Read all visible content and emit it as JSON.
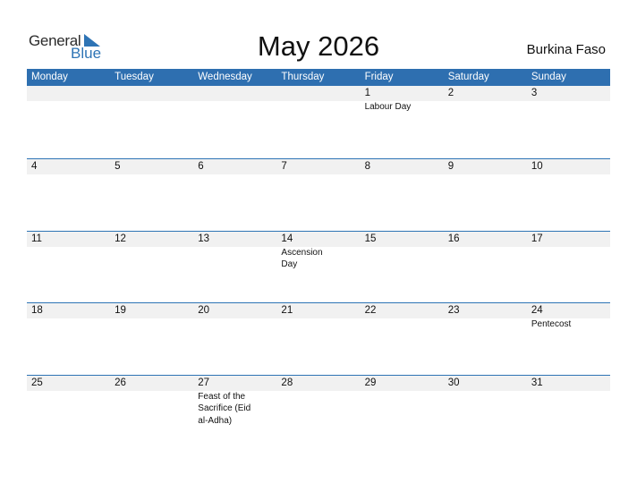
{
  "logo": {
    "general": "General",
    "blue": "Blue"
  },
  "title": "May 2026",
  "country": "Burkina Faso",
  "colors": {
    "accent": "#2e74b5",
    "header_bg": "#2e6fb0",
    "date_strip": "#f1f1f1"
  },
  "weekdays": [
    "Monday",
    "Tuesday",
    "Wednesday",
    "Thursday",
    "Friday",
    "Saturday",
    "Sunday"
  ],
  "weeks": [
    {
      "days": [
        "",
        "",
        "",
        "",
        "1",
        "2",
        "3"
      ],
      "events": [
        "",
        "",
        "",
        "",
        "Labour Day",
        "",
        ""
      ]
    },
    {
      "days": [
        "4",
        "5",
        "6",
        "7",
        "8",
        "9",
        "10"
      ],
      "events": [
        "",
        "",
        "",
        "",
        "",
        "",
        ""
      ]
    },
    {
      "days": [
        "11",
        "12",
        "13",
        "14",
        "15",
        "16",
        "17"
      ],
      "events": [
        "",
        "",
        "",
        "Ascension Day",
        "",
        "",
        ""
      ]
    },
    {
      "days": [
        "18",
        "19",
        "20",
        "21",
        "22",
        "23",
        "24"
      ],
      "events": [
        "",
        "",
        "",
        "",
        "",
        "",
        "Pentecost"
      ]
    },
    {
      "days": [
        "25",
        "26",
        "27",
        "28",
        "29",
        "30",
        "31"
      ],
      "events": [
        "",
        "",
        "Feast of the Sacrifice (Eid al-Adha)",
        "",
        "",
        "",
        ""
      ]
    }
  ]
}
